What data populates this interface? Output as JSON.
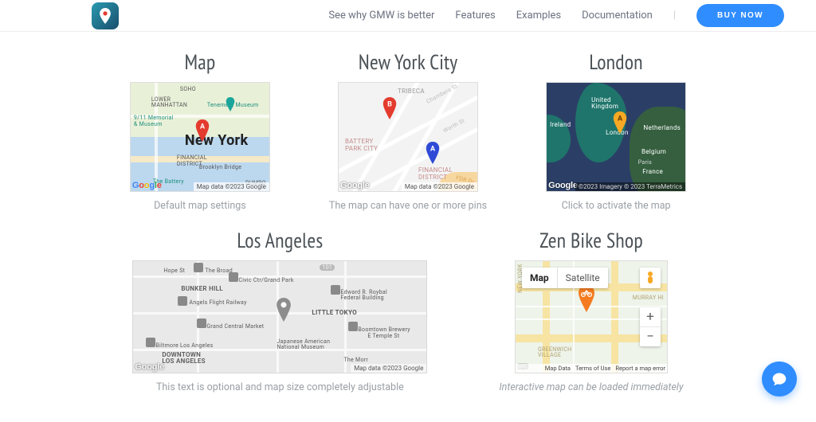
{
  "nav": {
    "items": [
      {
        "label": "See why GMW is better"
      },
      {
        "label": "Features"
      },
      {
        "label": "Examples"
      },
      {
        "label": "Documentation"
      }
    ],
    "buy_now": "BUY NOW"
  },
  "cards": {
    "map": {
      "title": "Map",
      "caption": "Default map settings",
      "big_label": "New York",
      "attribution": "Map data ©2023 Google",
      "glogo": "Google"
    },
    "nyc": {
      "title": "New York City",
      "caption": "The map can have one or more pins",
      "attribution": "Map data ©2023 Google",
      "glogo": "Google",
      "districts": {
        "battery": "BATTERY\nPARK CITY",
        "financial": "FINANCIAL\nDISTRICT",
        "tribeca": "TRIBECA"
      }
    },
    "london": {
      "title": "London",
      "caption": "Click to activate the map",
      "attribution": "©2023  Imagery © 2023 TerraMetrics",
      "glogo": "Google",
      "labels": {
        "uk": "United\nKingdom",
        "ireland": "Ireland",
        "netherlands": "Netherlands",
        "belgium": "Belgium",
        "france": "France",
        "paris": "Paris",
        "london": "London"
      }
    },
    "la": {
      "title": "Los Angeles",
      "caption": "This text is optional and map size completely adjustable",
      "attribution": "Map data ©2023 Google",
      "glogo": "Google",
      "labels": {
        "bunker": "BUNKER HILL",
        "downtown": "DOWNTOWN\nLOS ANGELES",
        "little_tokyo": "LITTLE TOKYO",
        "broad": "The Broad",
        "grand_park": "Civic Ctr/Grand Park",
        "angels_flight": "Angels Flight Railway",
        "central_market": "Grand Central Market",
        "biltmore": "Biltmore Los Angeles",
        "janm": "Japanese American\nNational Museum",
        "roybal": "Edward R. Roybal\nFederal Building",
        "boomtown": "Boomtown Brewery",
        "morr": "The Morr",
        "temple": "E Temple St",
        "hope": "Hope St",
        "hwy": "101"
      }
    },
    "zen": {
      "title": "Zen Bike Shop",
      "caption": "Interactive map can be loaded immediately",
      "tab_map": "Map",
      "tab_sat": "Satellite",
      "zoom_in": "+",
      "zoom_out": "−",
      "attr_mapdata": "Map Data",
      "attr_terms": "Terms of Use",
      "attr_report": "Report a map error",
      "labels": {
        "murray": "MURRAY HI",
        "greenwich": "GREENWICH\nVILLAGE",
        "ny": "NEW YORK"
      }
    }
  },
  "colors": {
    "accent": "#2f8dff",
    "pin_red": "#e33b2e",
    "pin_blue": "#2f4bd6",
    "pin_yellow": "#f7a824",
    "pin_orange": "#f47b20",
    "teal_land": "#1f756b",
    "ocean": "#2b3f66",
    "map_road_beige": "#f5e9c8"
  }
}
